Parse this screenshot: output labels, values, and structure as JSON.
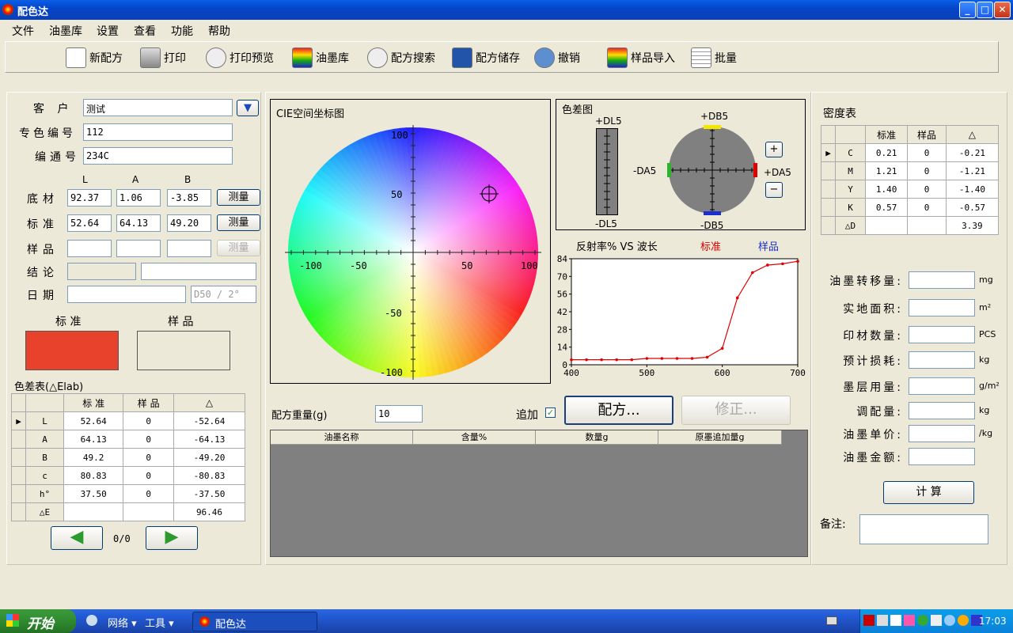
{
  "window": {
    "title": "配色达"
  },
  "menu": [
    "文件",
    "油墨库",
    "设置",
    "查看",
    "功能",
    "帮助"
  ],
  "toolbar": [
    "新配方",
    "打印",
    "打印预览",
    "油墨库",
    "配方搜索",
    "配方储存",
    "撤销",
    "样品导入",
    "批量"
  ],
  "left": {
    "customer_label": "客  户",
    "customer_value": "测试",
    "spot_label": "专色编号",
    "spot_value": "112",
    "code_label": "编通号",
    "code_value": "234C",
    "col_L": "L",
    "col_A": "A",
    "col_B": "B",
    "substrate_label": "底材",
    "substrate": [
      "92.37",
      "1.06",
      "-3.85"
    ],
    "standard_label": "标准",
    "standard": [
      "52.64",
      "64.13",
      "49.20"
    ],
    "sample_label": "样品",
    "measure": "测量",
    "conclusion_label": "结论",
    "date_label": "日期",
    "illuminant": "D50 / 2°",
    "swatch_std_label": "标 准",
    "swatch_sample_label": "样 品",
    "std_color": "#e8412c",
    "table_title": "色差表(△Elab)",
    "table_headers": [
      "标 准",
      "样 品",
      "△"
    ],
    "rows": [
      {
        "name": "L",
        "std": "52.64",
        "smp": "0",
        "d": "-52.64"
      },
      {
        "name": "A",
        "std": "64.13",
        "smp": "0",
        "d": "-64.13"
      },
      {
        "name": "B",
        "std": "49.2",
        "smp": "0",
        "d": "-49.20"
      },
      {
        "name": "c",
        "std": "80.83",
        "smp": "0",
        "d": "-80.83"
      },
      {
        "name": "h°",
        "std": "37.50",
        "smp": "0",
        "d": "-37.50"
      },
      {
        "name": "△E",
        "std": "",
        "smp": "",
        "d": "96.46"
      }
    ],
    "page": "0/0"
  },
  "cie": {
    "title": "CIE空间坐标图",
    "ticks_x": [
      "-100",
      "-50",
      "50",
      "100"
    ],
    "ticks_y": [
      "100",
      "50",
      "-50",
      "-100"
    ]
  },
  "diff": {
    "title": "色差图",
    "dl_pos": "+DL5",
    "dl_neg": "-DL5",
    "db_pos": "+DB5",
    "db_neg": "-DB5",
    "da_pos": "+DA5",
    "da_neg": "-DA5",
    "plus": "+",
    "minus": "−"
  },
  "reflect": {
    "title": "反射率% VS 波长",
    "std_label": "标准",
    "sample_label": "样品"
  },
  "chart_data": {
    "type": "line",
    "title": "反射率% VS 波长",
    "xlabel": "",
    "ylabel": "",
    "xlim": [
      400,
      700
    ],
    "ylim": [
      0,
      84
    ],
    "x_ticks": [
      "400",
      "500",
      "600",
      "700"
    ],
    "y_ticks": [
      "0",
      "14",
      "28",
      "42",
      "56",
      "70",
      "84"
    ],
    "series": [
      {
        "name": "标准",
        "color": "#e00000",
        "x": [
          400,
          420,
          440,
          460,
          480,
          500,
          520,
          540,
          560,
          580,
          600,
          620,
          640,
          660,
          680,
          700
        ],
        "y": [
          4,
          4,
          4,
          4,
          4,
          5,
          5,
          5,
          5,
          6,
          13,
          53,
          73,
          79,
          80,
          82
        ]
      }
    ]
  },
  "mid": {
    "weight_label": "配方重量(g)",
    "weight_value": "10",
    "append_label": "追加",
    "formula_btn": "配方...",
    "fix_btn": "修正...",
    "grid_headers": [
      "油墨名称",
      "含量%",
      "数量g",
      "原墨追加量g"
    ]
  },
  "density": {
    "title": "密度表",
    "headers": [
      "标准",
      "样品",
      "△"
    ],
    "rows": [
      {
        "name": "C",
        "std": "0.21",
        "smp": "0",
        "d": "-0.21"
      },
      {
        "name": "M",
        "std": "1.21",
        "smp": "0",
        "d": "-1.21"
      },
      {
        "name": "Y",
        "std": "1.40",
        "smp": "0",
        "d": "-1.40"
      },
      {
        "name": "K",
        "std": "0.57",
        "smp": "0",
        "d": "-0.57"
      },
      {
        "name": "△D",
        "std": "",
        "smp": "",
        "d": "3.39"
      }
    ]
  },
  "calc": {
    "fields": [
      {
        "label": "油墨转移量:",
        "unit": "mg"
      },
      {
        "label": "实地面积:",
        "unit": "m²"
      },
      {
        "label": "印材数量:",
        "unit": "PCS"
      },
      {
        "label": "预计损耗:",
        "unit": "kg"
      },
      {
        "label": "墨层用量:",
        "unit": "g/m²"
      },
      {
        "label": "调配量:",
        "unit": "kg"
      },
      {
        "label": "油墨单价:",
        "unit": "/kg"
      },
      {
        "label": "油墨金额:",
        "unit": ""
      }
    ],
    "calc_btn": "计 算",
    "remark_label": "备注:"
  },
  "taskbar": {
    "start": "开始",
    "net": "网络",
    "tools": "工具",
    "task": "配色达",
    "time": "17:03"
  }
}
